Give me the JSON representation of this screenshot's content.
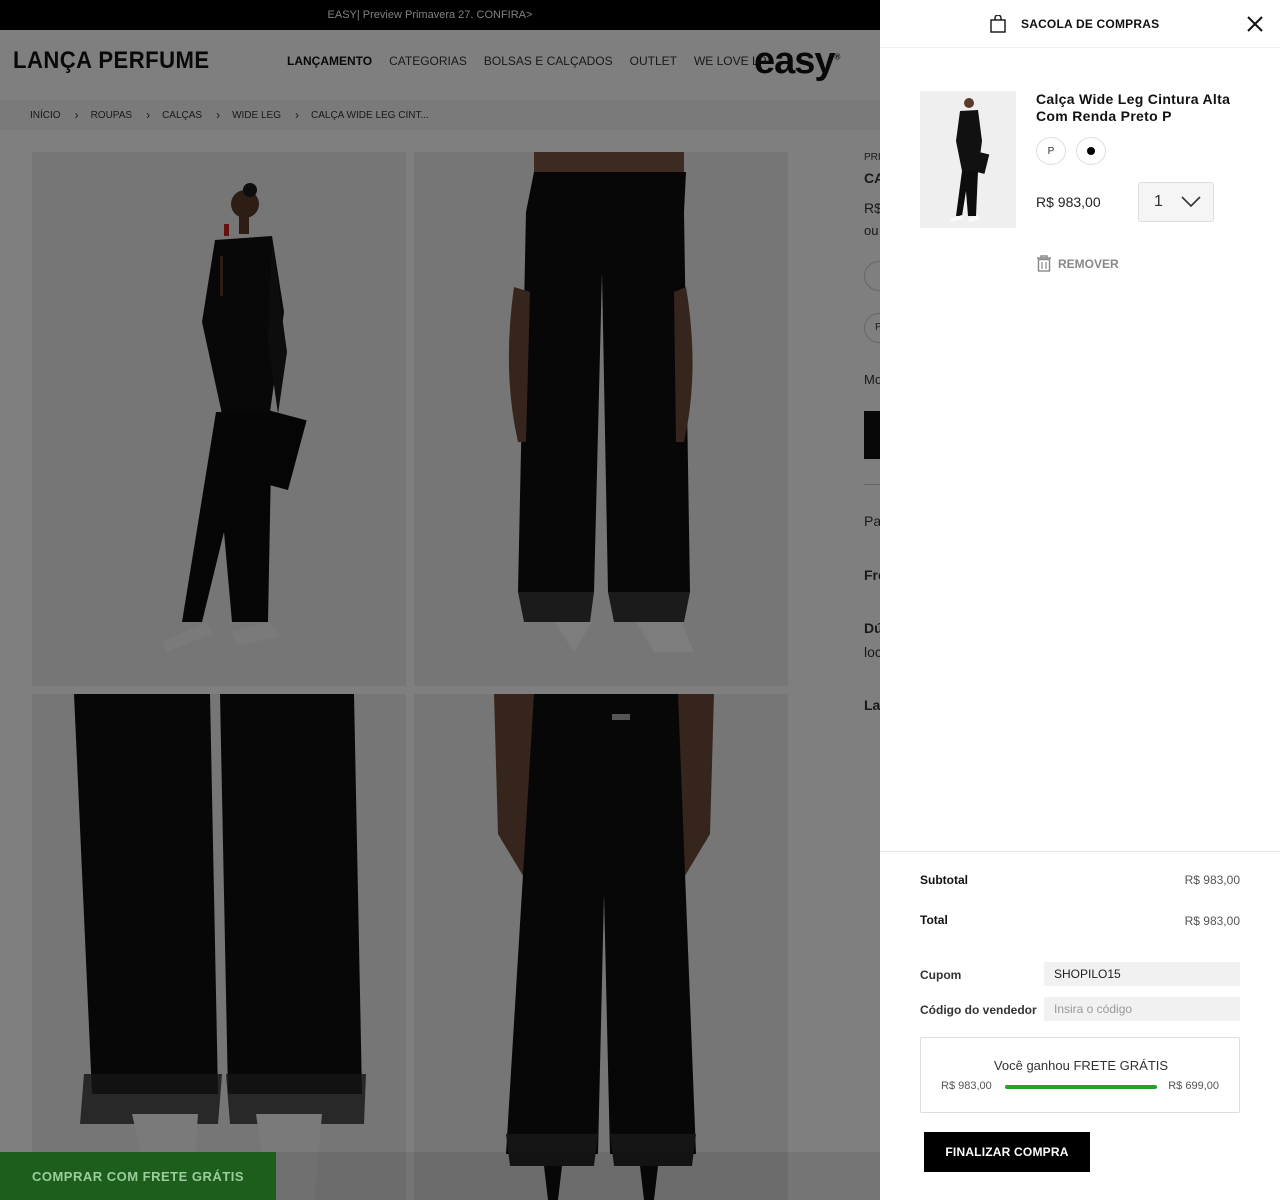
{
  "announcement": "EASY| Preview Primavera 27. CONFIRA>",
  "brand": {
    "logo": "LANÇA PERFUME",
    "sub_brand": "easy"
  },
  "nav": [
    "LANÇAMENTO",
    "CATEGORIAS",
    "BOLSAS E CALÇADOS",
    "OUTLET",
    "WE LOVE LP"
  ],
  "breadcrumb": [
    "INÍCIO",
    "ROUPAS",
    "CALÇAS",
    "WIDE LEG",
    "CALÇA WIDE LEG CINT..."
  ],
  "product_partial": {
    "l1": "PRI",
    "l2": "CA",
    "l3": "R$",
    "l4": "ou",
    "l5": "P",
    "l6": "Mo",
    "l7": "Pa",
    "l8": "Fre",
    "l9": "Dú",
    "l10": "loc",
    "l11": "Lar"
  },
  "free_shipping_button": "COMPRAR COM FRETE GRÁTIS",
  "cart": {
    "title": "SACOLA DE COMPRAS",
    "item": {
      "name": "Calça Wide Leg Cintura Alta Com Renda Preto P",
      "size": "P",
      "color": "#000000",
      "price": "R$ 983,00",
      "quantity": "1",
      "remove_label": "REMOVER"
    },
    "subtotal_label": "Subtotal",
    "subtotal_value": "R$ 983,00",
    "total_label": "Total",
    "total_value": "R$ 983,00",
    "coupon_label": "Cupom",
    "coupon_value": "SHOPILO15",
    "seller_label": "Código do vendedor",
    "seller_placeholder": "Insira o código",
    "shipping": {
      "message": "Você ganhou FRETE GRÁTIS",
      "current": "R$ 983,00",
      "threshold": "R$ 699,00",
      "progress": 1.0
    },
    "checkout_label": "FINALIZAR COMPRA"
  },
  "colors": {
    "accent_green": "#25a12b",
    "free_ship_bg": "#1d5e1d"
  }
}
